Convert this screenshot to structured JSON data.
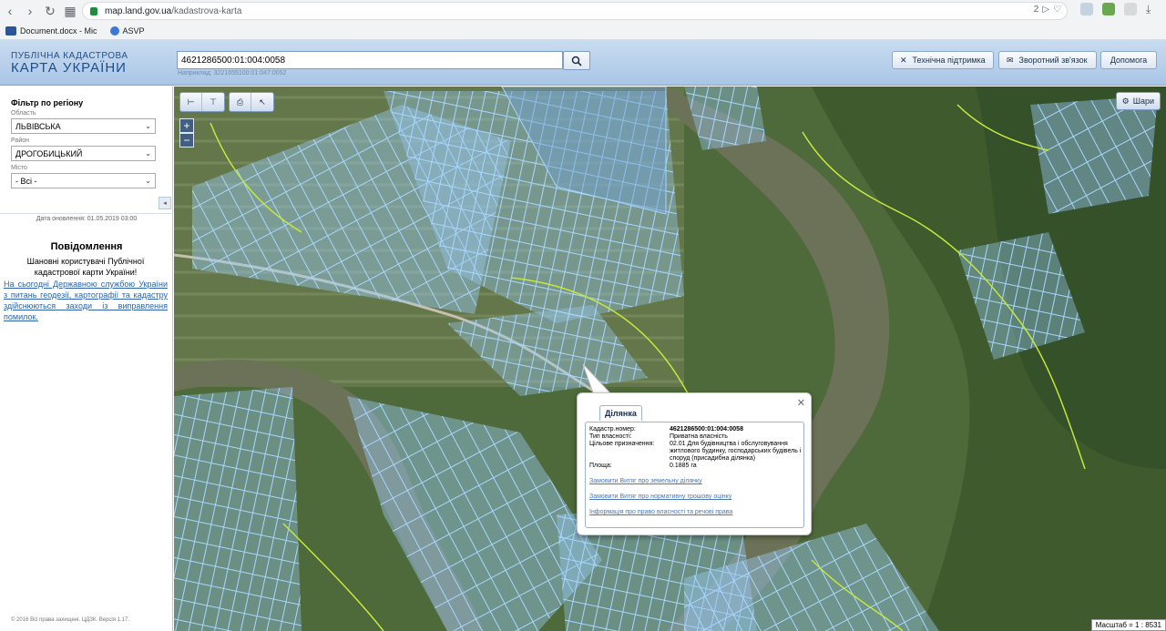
{
  "browser": {
    "url_host": "map.land.gov.ua",
    "url_path": "/kadastrova-karta",
    "ext_count": "2",
    "bookmarks": [
      {
        "label": "Document.docx - Mic",
        "color": "#2b579a"
      },
      {
        "label": "ASVP",
        "color": "#3c78d8"
      }
    ]
  },
  "header": {
    "logo_line1": "ПУБЛІЧНА КАДАСТРОВА",
    "logo_line2": "КАРТА УКРАЇНИ",
    "search_value": "4621286500:01:004:0058",
    "search_hint": "Наприклад: 3221655100:01:047:0052",
    "buttons": {
      "support": "Технічна підтримка",
      "feedback": "Зворотний зв'язок",
      "help": "Допомога"
    }
  },
  "sidebar": {
    "filter_title": "Фільтр по регіону",
    "region_label": "Область",
    "region_value": "ЛЬВІВСЬКА",
    "district_label": "Район",
    "district_value": "ДРОГОБИЦЬКИЙ",
    "city_label": "Місто",
    "city_value": "- Всі -",
    "update_date": "Дата оновлення: 01.05.2019 03:00",
    "notice_title": "Повідомлення",
    "notice_body": "Шановні користувачі Публічної кадастрової карти України!",
    "notice_link": "На сьогодні Державною службою України з питань геодезії, картографії та кадастру здійснюються заходи із виправлення помилок.",
    "footer": "© 2016 Всі права захищені. ЦДЗК. Версія 1.17."
  },
  "map": {
    "layers_label": "Шари",
    "scale_label": "Масштаб = 1 : 8531"
  },
  "popup": {
    "tab_label": "Ділянка",
    "rows": [
      {
        "label": "Кадастр.номер:",
        "value": "4621286500:01:004:0058"
      },
      {
        "label": "Тип власності:",
        "value": "Приватна власність"
      },
      {
        "label": "Цільове призначення:",
        "value": "02.01 Для будівництва і обслуговування житлового будинку, господарських будівель і споруд (присадибна ділянка)"
      },
      {
        "label": "Площа:",
        "value": "0.1885 га"
      }
    ],
    "links": {
      "extract_land": "Замовити Витяг про земельну ділянку",
      "extract_valuation": "Замовити Витяг про нормативну грошову оцінку",
      "ownership_info": "Інформація про право власності та речові права"
    }
  }
}
